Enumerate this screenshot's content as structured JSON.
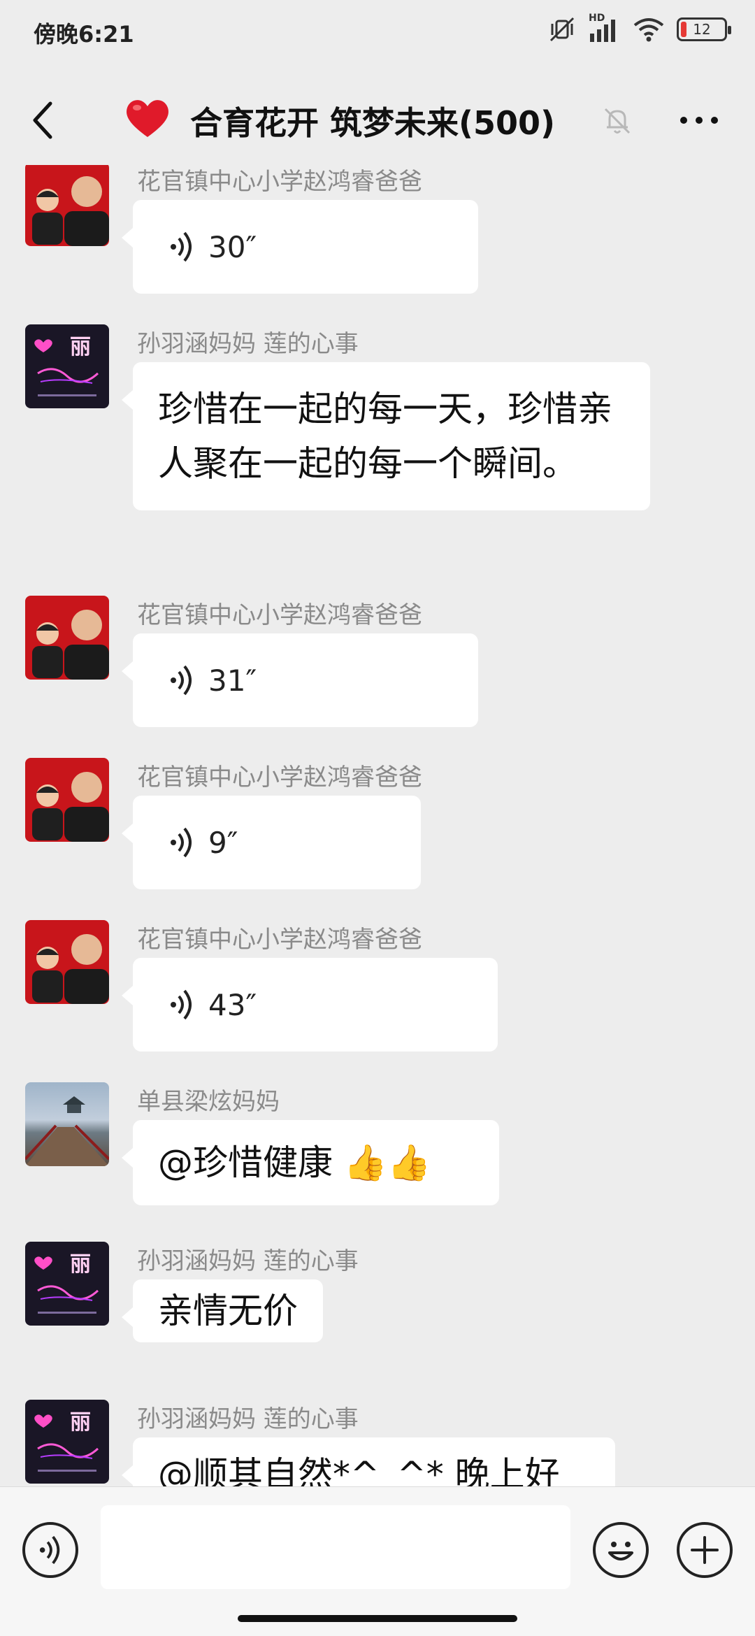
{
  "status_bar": {
    "time": "傍晚6:21",
    "battery": "12",
    "signal_label": "HD"
  },
  "header": {
    "title": "合育花开 筑梦未来(500)"
  },
  "messages": [
    {
      "sender": "花官镇中心小学赵鸿睿爸爸",
      "type": "voice",
      "duration": "30″",
      "avatar": "family-photo"
    },
    {
      "sender": "孙羽涵妈妈  莲的心事",
      "type": "text",
      "text": "珍惜在一起的每一天，珍惜亲人聚在一起的每一个瞬间。",
      "avatar": "neon-li"
    },
    {
      "sender": "花官镇中心小学赵鸿睿爸爸",
      "type": "voice",
      "duration": "31″",
      "avatar": "family-photo"
    },
    {
      "sender": "花官镇中心小学赵鸿睿爸爸",
      "type": "voice",
      "duration": "9″",
      "avatar": "family-photo"
    },
    {
      "sender": "花官镇中心小学赵鸿睿爸爸",
      "type": "voice",
      "duration": "43″",
      "avatar": "family-photo"
    },
    {
      "sender": "单县梁炫妈妈",
      "type": "text",
      "text": "@珍惜健康 👍👍",
      "avatar": "lake-pavilion"
    },
    {
      "sender": "孙羽涵妈妈  莲的心事",
      "type": "text",
      "text": "亲情无价",
      "avatar": "neon-li"
    },
    {
      "sender": "孙羽涵妈妈  莲的心事",
      "type": "text",
      "text": "@顺其自然*^_^*  晚上好",
      "avatar": "neon-li"
    }
  ],
  "input_bar": {
    "placeholder": ""
  },
  "colors": {
    "background": "#ededed",
    "bubble": "#ffffff",
    "battery_low": "#e53935"
  },
  "icons": [
    "back-arrow-icon",
    "heart-icon",
    "mute-bell-icon",
    "more-icon",
    "voice-icon",
    "emoji-icon",
    "plus-icon"
  ]
}
